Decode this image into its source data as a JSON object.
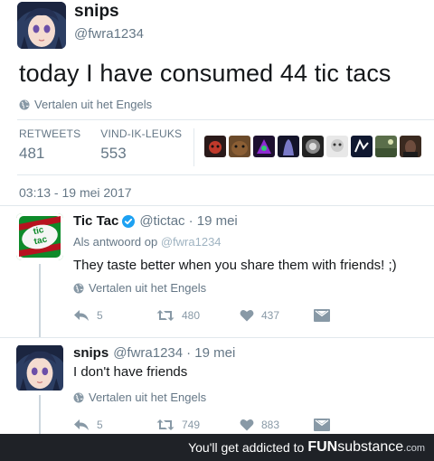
{
  "main_tweet": {
    "display_name": "snips",
    "handle": "@fwra1234",
    "text": "today I have consumed 44 tic tacs",
    "translate": "Vertalen uit het Engels",
    "stats": {
      "retweets_label": "RETWEETS",
      "retweets_value": "481",
      "likes_label": "VIND-IK-LEUKS",
      "likes_value": "553"
    },
    "timestamp": "03:13 - 19 mei 2017"
  },
  "replies": [
    {
      "display_name": "Tic Tac",
      "handle": "@tictac",
      "time": "· 19 mei",
      "reply_to_label": "Als antwoord op",
      "reply_to_handle": "@fwra1234",
      "text": "They taste better when you share them with friends! ;)",
      "translate": "Vertalen uit het Engels",
      "replies": "5",
      "retweets": "480",
      "likes": "437",
      "avatar_text": "tic tac"
    },
    {
      "display_name": "snips",
      "handle": "@fwra1234",
      "time": "· 19 mei",
      "text": "I don't have friends",
      "translate": "Vertalen uit het Engels",
      "replies": "5",
      "retweets": "749",
      "likes": "883"
    }
  ],
  "footer": {
    "tagline": "You'll get addicted to",
    "brand_fun": "FUN",
    "brand_sub": "substance",
    "brand_com": ".com"
  },
  "colors": {
    "text": "#14171a",
    "muted": "#657786",
    "verified": "#1da1f2",
    "tictac_green": "#0e8a2a",
    "footer_bg": "#1f2227"
  }
}
